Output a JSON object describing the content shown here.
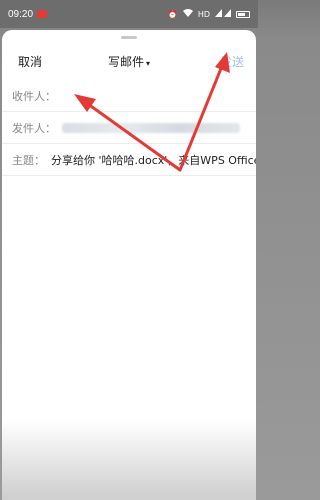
{
  "status_bar": {
    "time": "09:20",
    "network_label": "HD"
  },
  "header": {
    "cancel_label": "取消",
    "title": "写邮件",
    "title_caret": "▾",
    "send_label": "发送"
  },
  "fields": {
    "recipient_label": "收件人：",
    "sender_label": "发件人：",
    "subject_label": "主题：",
    "subject_value": "分享给你 '哈哈哈.docx'，来自WPS Office"
  },
  "colors": {
    "send_disabled": "#9fc7ef",
    "annotation_arrow": "#e53935"
  },
  "icons": [
    "alarm-icon",
    "wifi-icon",
    "signal-icon",
    "battery-icon",
    "chevron-down-icon"
  ]
}
